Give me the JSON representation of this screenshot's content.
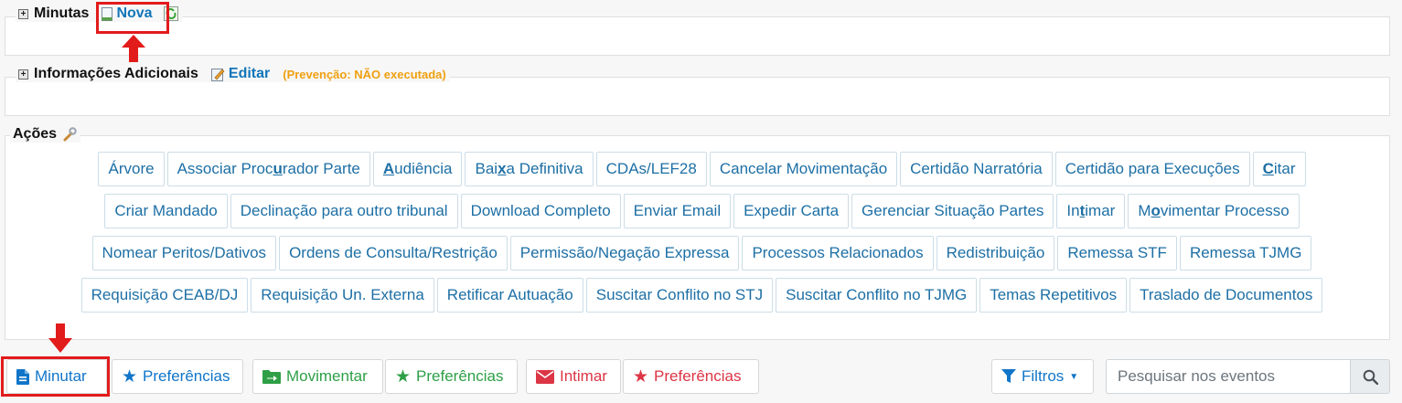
{
  "minutas": {
    "title": "Minutas",
    "nova_label": "Nova"
  },
  "info": {
    "title": "Informações Adicionais",
    "edit_label": "Editar",
    "prevencao": "(Prevenção:  NÃO executada)"
  },
  "acoes": {
    "title": "Ações",
    "rows": [
      [
        "Árvore",
        "Associar Procurador Parte",
        "Audiência",
        "Baixa Definitiva",
        "CDAs/LEF28",
        "Cancelar Movimentação",
        "Certidão Narratória",
        "Certidão para Execuções",
        "Citar"
      ],
      [
        "Criar Mandado",
        "Declinação para outro tribunal",
        "Download Completo",
        "Enviar Email",
        "Expedir Carta",
        "Gerenciar Situação Partes",
        "Intimar",
        "Movimentar Processo"
      ],
      [
        "Nomear Peritos/Dativos",
        "Ordens de Consulta/Restrição",
        "Permissão/Negação Expressa",
        "Processos Relacionados",
        "Redistribuição",
        "Remessa STF",
        "Remessa TJMG"
      ],
      [
        "Requisição CEAB/DJ",
        "Requisição Un. Externa",
        "Retificar Autuação",
        "Suscitar Conflito no STJ",
        "Suscitar Conflito no TJMG",
        "Temas Repetitivos",
        "Traslado de Documentos"
      ]
    ],
    "underline": {
      "0.1": [
        13,
        14
      ],
      "0.2": [
        0,
        1
      ],
      "0.3": [
        3,
        4
      ],
      "0.8": [
        0,
        1
      ],
      "1.6": [
        2,
        3
      ],
      "1.7": [
        1,
        2
      ]
    }
  },
  "toolbar": {
    "minutar": "Minutar",
    "pref1": "Preferências",
    "movimentar": "Movimentar",
    "pref2": "Preferências",
    "intimar": "Intimar",
    "pref3": "Preferências",
    "filtros": "Filtros",
    "search_placeholder": "Pesquisar nos eventos"
  },
  "colors": {
    "link": "#1175b9",
    "warning": "#f0a010",
    "green": "#2e9f46",
    "red": "#dc3545",
    "highlight": "#e21b1b"
  }
}
